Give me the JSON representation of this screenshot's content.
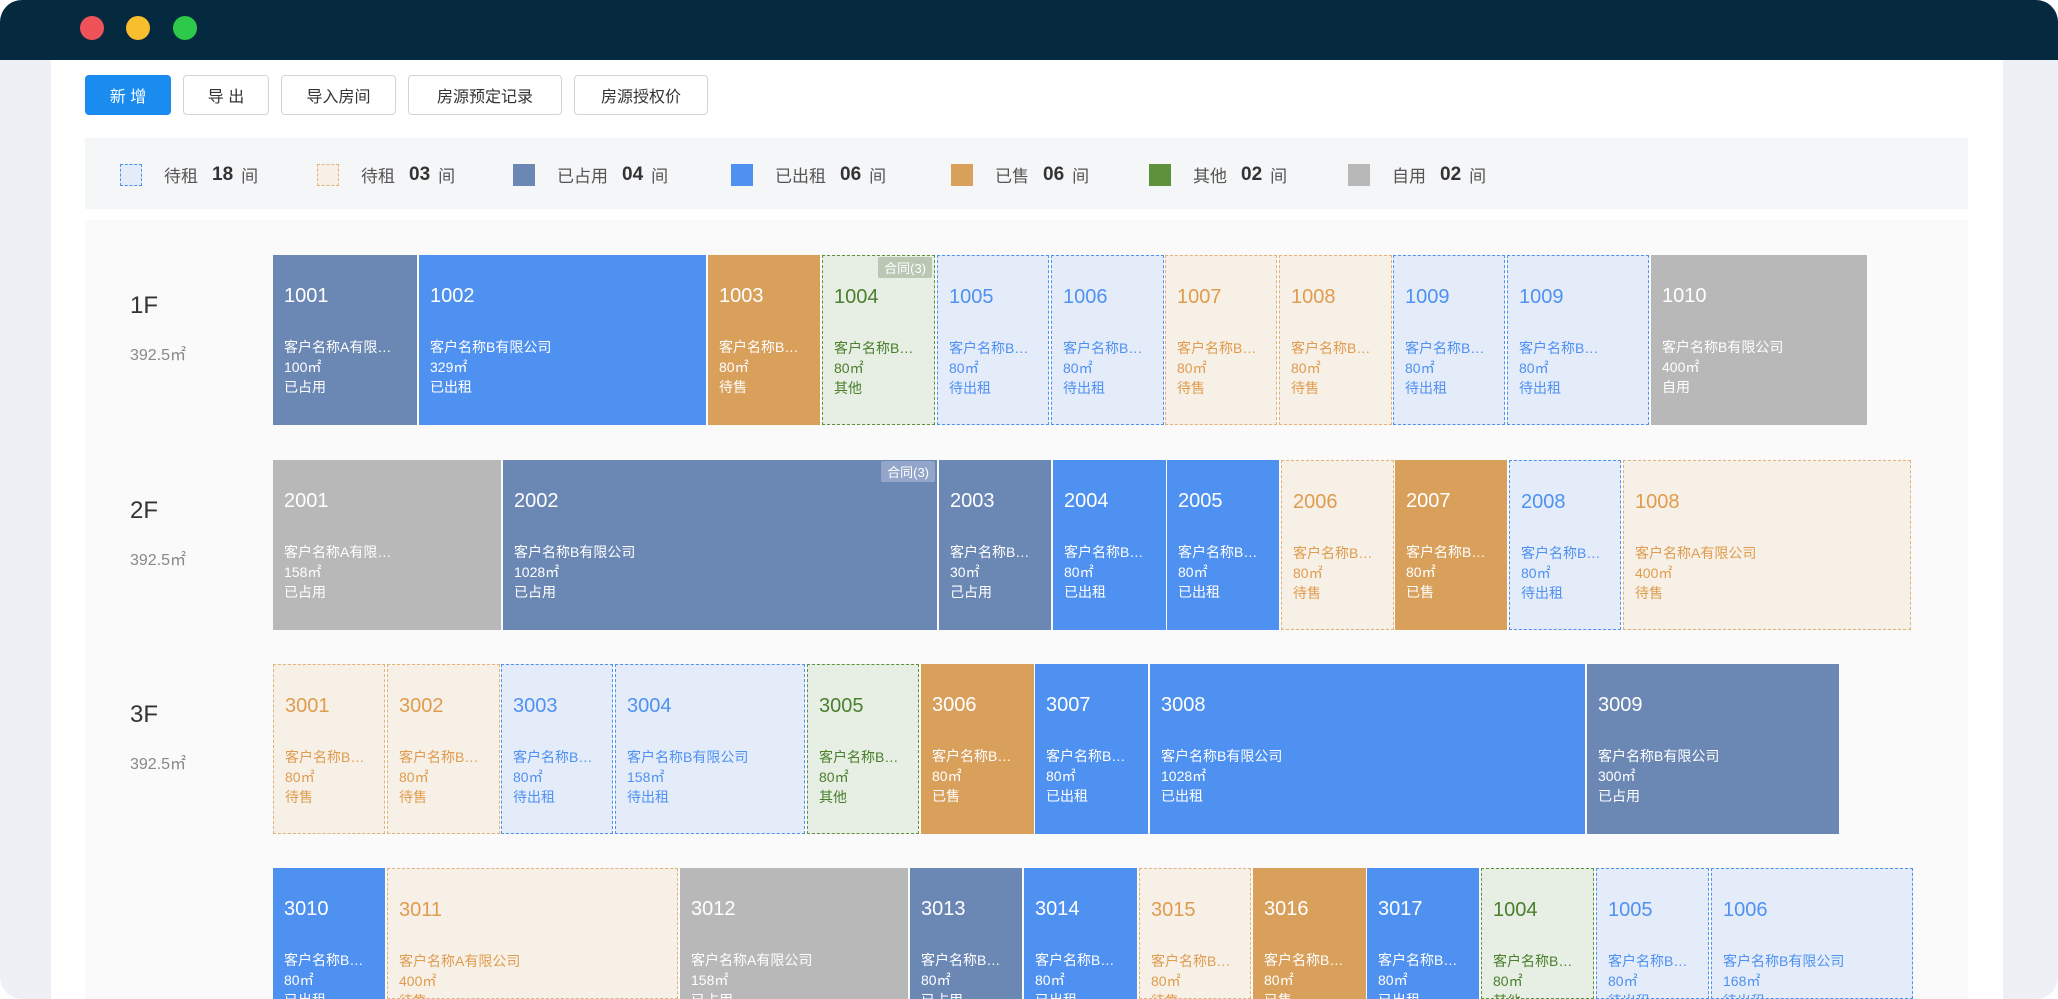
{
  "toolbar": {
    "add_label": "新 增",
    "export_label": "导 出",
    "import_label": "导入房间",
    "booking_label": "房源预定记录",
    "price_label": "房源授权价"
  },
  "legend": [
    {
      "label": "待租",
      "count": "18",
      "unit": "间",
      "style": "tr"
    },
    {
      "label": "待租",
      "count": "03",
      "unit": "间",
      "style": "ts"
    },
    {
      "label": "已占用",
      "count": "04",
      "unit": "间",
      "style": "occ"
    },
    {
      "label": "已出租",
      "count": "06",
      "unit": "间",
      "style": "rented"
    },
    {
      "label": "已售",
      "count": "06",
      "unit": "间",
      "style": "sold"
    },
    {
      "label": "其他",
      "count": "02",
      "unit": "间",
      "style": "other_solid"
    },
    {
      "label": "自用",
      "count": "02",
      "unit": "间",
      "style": "self"
    }
  ],
  "colors": {
    "occupied": "#6b88b5",
    "rented": "#4f91f0",
    "sold": "#d9a05c",
    "self_use": "#b8b8b8",
    "other": "#5e913a",
    "to_rent": "#4f91f0",
    "to_sell": "#e3b27a",
    "primary": "#1a8cf0",
    "titlebar": "#052a40"
  },
  "floors": [
    {
      "label": "1F",
      "area": "392.5㎡",
      "rooms": [
        {
          "num": "1001",
          "cust": "客户名称A有限…",
          "area": "100㎡",
          "status": "已占用",
          "style": "occ"
        },
        {
          "num": "1002",
          "cust": "客户名称B有限公司",
          "area": "329㎡",
          "status": "已出租",
          "style": "rented"
        },
        {
          "num": "1003",
          "cust": "客户名称B…",
          "area": "80㎡",
          "status": "待售",
          "style": "sold"
        },
        {
          "num": "1004",
          "cust": "客户名称B…",
          "area": "80㎡",
          "status": "其他",
          "style": "other",
          "badge": "合同(3)"
        },
        {
          "num": "1005",
          "cust": "客户名称B…",
          "area": "80㎡",
          "status": "待出租",
          "style": "tr"
        },
        {
          "num": "1006",
          "cust": "客户名称B…",
          "area": "80㎡",
          "status": "待出租",
          "style": "tr"
        },
        {
          "num": "1007",
          "cust": "客户名称B…",
          "area": "80㎡",
          "status": "待售",
          "style": "ts"
        },
        {
          "num": "1008",
          "cust": "客户名称B…",
          "area": "80㎡",
          "status": "待售",
          "style": "ts"
        },
        {
          "num": "1009",
          "cust": "客户名称B…",
          "area": "80㎡",
          "status": "待出租",
          "style": "tr"
        },
        {
          "num": "1009",
          "cust": "客户名称B…",
          "area": "80㎡",
          "status": "待出租",
          "style": "tr"
        },
        {
          "num": "1010",
          "cust": "客户名称B有限公司",
          "area": "400㎡",
          "status": "自用",
          "style": "self"
        }
      ]
    },
    {
      "label": "2F",
      "area": "392.5㎡",
      "rooms": [
        {
          "num": "2001",
          "cust": "客户名称A有限…",
          "area": "158㎡",
          "status": "已占用",
          "style": "self"
        },
        {
          "num": "2002",
          "cust": "客户名称B有限公司",
          "area": "1028㎡",
          "status": "已占用",
          "style": "occ",
          "badge": "合同(3)"
        },
        {
          "num": "2003",
          "cust": "客户名称B…",
          "area": "30㎡",
          "status": "己占用",
          "style": "occ"
        },
        {
          "num": "2004",
          "cust": "客户名称B…",
          "area": "80㎡",
          "status": "已出租",
          "style": "rented"
        },
        {
          "num": "2005",
          "cust": "客户名称B…",
          "area": "80㎡",
          "status": "已出租",
          "style": "rented"
        },
        {
          "num": "2006",
          "cust": "客户名称B…",
          "area": "80㎡",
          "status": "待售",
          "style": "ts"
        },
        {
          "num": "2007",
          "cust": "客户名称B…",
          "area": "80㎡",
          "status": "已售",
          "style": "sold"
        },
        {
          "num": "2008",
          "cust": "客户名称B…",
          "area": "80㎡",
          "status": "待出租",
          "style": "tr"
        },
        {
          "num": "1008",
          "cust": "客户名称A有限公司",
          "area": "400㎡",
          "status": "待售",
          "style": "ts"
        }
      ]
    },
    {
      "label": "3F",
      "area": "392.5㎡",
      "rooms": [
        {
          "num": "3001",
          "cust": "客户名称B…",
          "area": "80㎡",
          "status": "待售",
          "style": "ts"
        },
        {
          "num": "3002",
          "cust": "客户名称B…",
          "area": "80㎡",
          "status": "待售",
          "style": "ts"
        },
        {
          "num": "3003",
          "cust": "客户名称B…",
          "area": "80㎡",
          "status": "待出租",
          "style": "tr"
        },
        {
          "num": "3004",
          "cust": "客户名称B有限公司",
          "area": "158㎡",
          "status": "待出租",
          "style": "tr"
        },
        {
          "num": "3005",
          "cust": "客户名称B…",
          "area": "80㎡",
          "status": "其他",
          "style": "other"
        },
        {
          "num": "3006",
          "cust": "客户名称B…",
          "area": "80㎡",
          "status": "已售",
          "style": "sold"
        },
        {
          "num": "3007",
          "cust": "客户名称B…",
          "area": "80㎡",
          "status": "已出租",
          "style": "rented"
        },
        {
          "num": "3008",
          "cust": "客户名称B有限公司",
          "area": "1028㎡",
          "status": "已出租",
          "style": "rented"
        },
        {
          "num": "3009",
          "cust": "客户名称B有限公司",
          "area": "300㎡",
          "status": "已占用",
          "style": "occ"
        }
      ]
    },
    {
      "label": "",
      "area": "",
      "rooms": [
        {
          "num": "3010",
          "cust": "客户名称B…",
          "area": "80㎡",
          "status": "已出租",
          "style": "rented"
        },
        {
          "num": "3011",
          "cust": "客户名称A有限公司",
          "area": "400㎡",
          "status": "待售",
          "style": "ts"
        },
        {
          "num": "3012",
          "cust": "客户名称A有限公司",
          "area": "158㎡",
          "status": "已占用",
          "style": "self"
        },
        {
          "num": "3013",
          "cust": "客户名称B…",
          "area": "80㎡",
          "status": "已占用",
          "style": "occ"
        },
        {
          "num": "3014",
          "cust": "客户名称B…",
          "area": "80㎡",
          "status": "已出租",
          "style": "rented"
        },
        {
          "num": "3015",
          "cust": "客户名称B…",
          "area": "80㎡",
          "status": "待售",
          "style": "ts"
        },
        {
          "num": "3016",
          "cust": "客户名称B…",
          "area": "80㎡",
          "status": "已售",
          "style": "sold"
        },
        {
          "num": "3017",
          "cust": "客户名称B…",
          "area": "80㎡",
          "status": "已出租",
          "style": "rented"
        },
        {
          "num": "1004",
          "cust": "客户名称B…",
          "area": "80㎡",
          "status": "其他",
          "style": "other"
        },
        {
          "num": "1005",
          "cust": "客户名称B…",
          "area": "80㎡",
          "status": "待出租",
          "style": "tr"
        },
        {
          "num": "1006",
          "cust": "客户名称B有限公司",
          "area": "168㎡",
          "status": "待出租",
          "style": "tr"
        }
      ]
    }
  ]
}
